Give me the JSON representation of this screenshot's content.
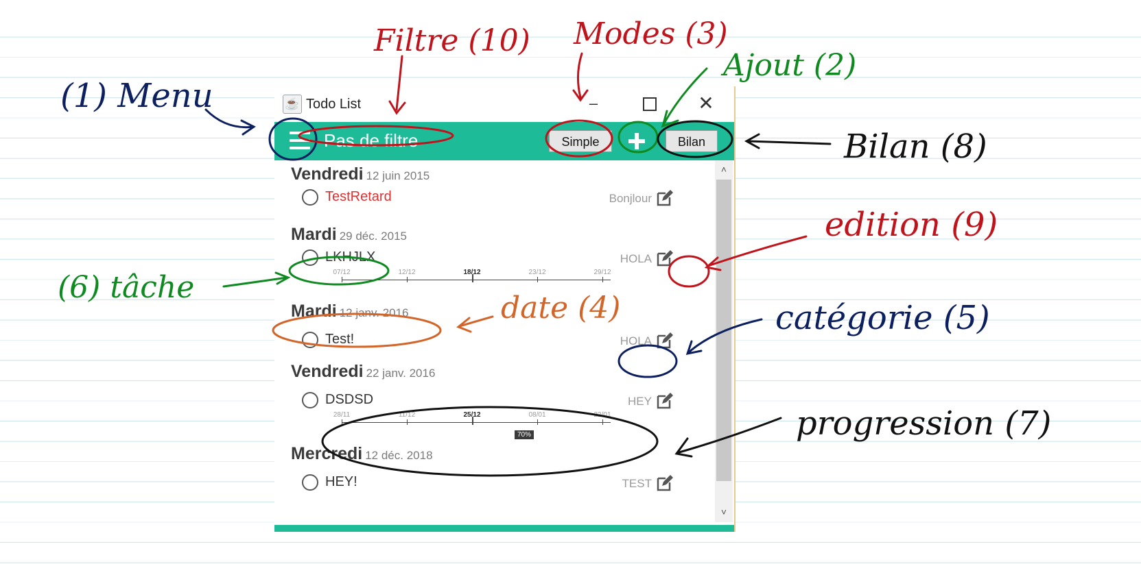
{
  "window": {
    "title": "Todo List",
    "app_icon": "java-cup-icon",
    "controls": {
      "minimize": "–",
      "maximize": "□",
      "close": "✕"
    }
  },
  "toolbar": {
    "menu_icon": "hamburger-icon",
    "filter_label": "Pas de filtre",
    "mode_button": "Simple",
    "add_icon": "plus-icon",
    "bilan_button": "Bilan",
    "accent_color": "#1dbb98"
  },
  "groups": [
    {
      "day": "Vendredi",
      "date": "12 juin 2015",
      "tasks": [
        {
          "label": "TestRetard",
          "category": "Bonjlour",
          "late": true
        }
      ]
    },
    {
      "day": "Mardi",
      "date": "29 déc. 2015",
      "tasks": [
        {
          "label": "LKHJLX",
          "category": "HOLA",
          "timeline": {
            "labels": [
              "07/12",
              "12/12",
              "18/12",
              "23/12",
              "29/12"
            ],
            "current": "18/12"
          }
        }
      ]
    },
    {
      "day": "Mardi",
      "date": "12 janv. 2016",
      "tasks": [
        {
          "label": "Test!",
          "category": "HOLA"
        }
      ]
    },
    {
      "day": "Vendredi",
      "date": "22 janv. 2016",
      "tasks": [
        {
          "label": "DSDSD",
          "category": "HEY",
          "timeline": {
            "labels": [
              "28/11",
              "11/12",
              "25/12",
              "08/01",
              "22/01"
            ],
            "current": "25/12",
            "progress_label": "70%",
            "progress": 0.7
          }
        }
      ]
    },
    {
      "day": "Mercredi",
      "date": "12 déc. 2018",
      "tasks": [
        {
          "label": "HEY!",
          "category": "TEST"
        }
      ]
    }
  ],
  "annotations": {
    "menu": "(1) Menu",
    "filter": "Filtre (10)",
    "modes": "Modes (3)",
    "add": "Ajout (2)",
    "bilan": "Bilan (8)",
    "edition": "edition (9)",
    "task": "(6) tâche",
    "date": "date (4)",
    "category": "catégorie (5)",
    "progression": "progression (7)",
    "colors": {
      "red": "#c0141c",
      "green": "#0f8a20",
      "navy": "#0c1f5e",
      "orange": "#d2662a",
      "black": "#111111"
    }
  }
}
